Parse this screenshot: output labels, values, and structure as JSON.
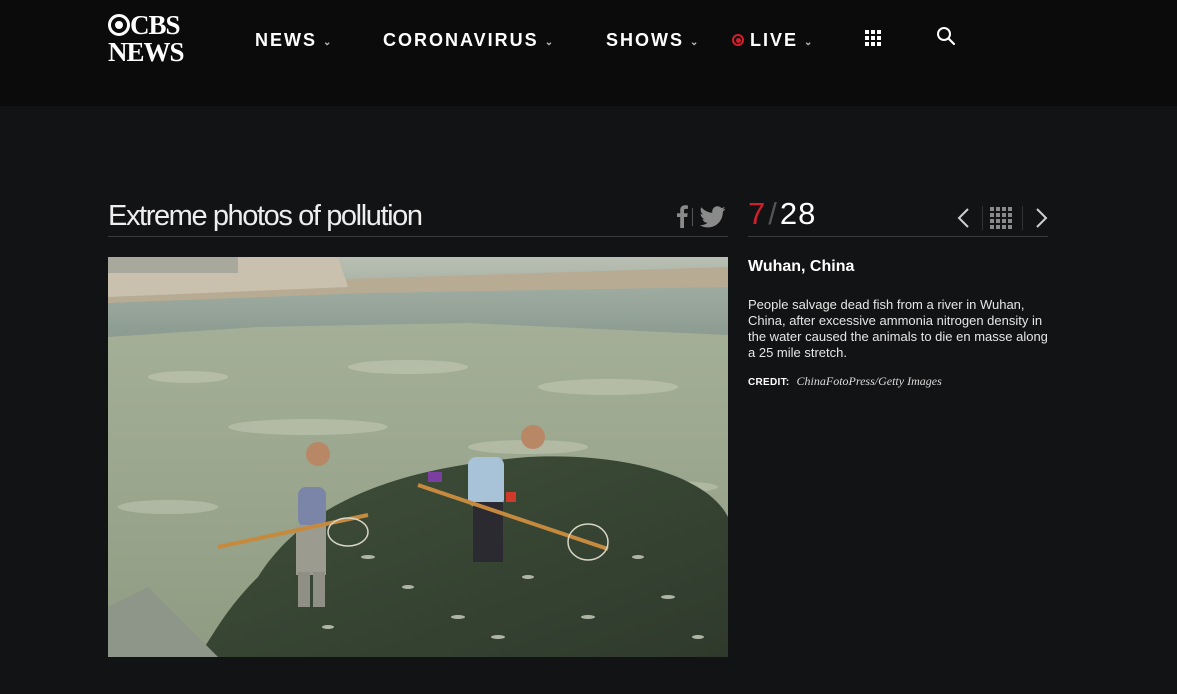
{
  "header": {
    "logo_line1": "CBS",
    "logo_line2": "NEWS",
    "nav": [
      {
        "label": "NEWS"
      },
      {
        "label": "CORONAVIRUS"
      },
      {
        "label": "SHOWS"
      },
      {
        "label": "LIVE"
      }
    ]
  },
  "gallery": {
    "title": "Extreme photos of pollution",
    "current": "7",
    "separator": "/",
    "total": "28"
  },
  "slide": {
    "title": "Wuhan, China",
    "caption": "People salvage dead fish from a river in Wuhan, China, after excessive ammonia nitrogen density in the water caused the animals to die en masse along a 25 mile stretch.",
    "credit_label": "CREDIT:",
    "credit_value": "ChinaFotoPress/Getty Images"
  },
  "icons": {
    "nav_chevron": "chevron-down-icon",
    "live": "live-dot-icon",
    "menu": "grid-menu-icon",
    "search": "search-icon",
    "share_facebook": "facebook-icon",
    "share_twitter": "twitter-icon",
    "prev": "chevron-left-icon",
    "gallery_grid": "grid-icon",
    "next": "chevron-right-icon"
  },
  "colors": {
    "background": "#121315",
    "header": "#0b0b0c",
    "accent_red": "#d21f2b"
  }
}
